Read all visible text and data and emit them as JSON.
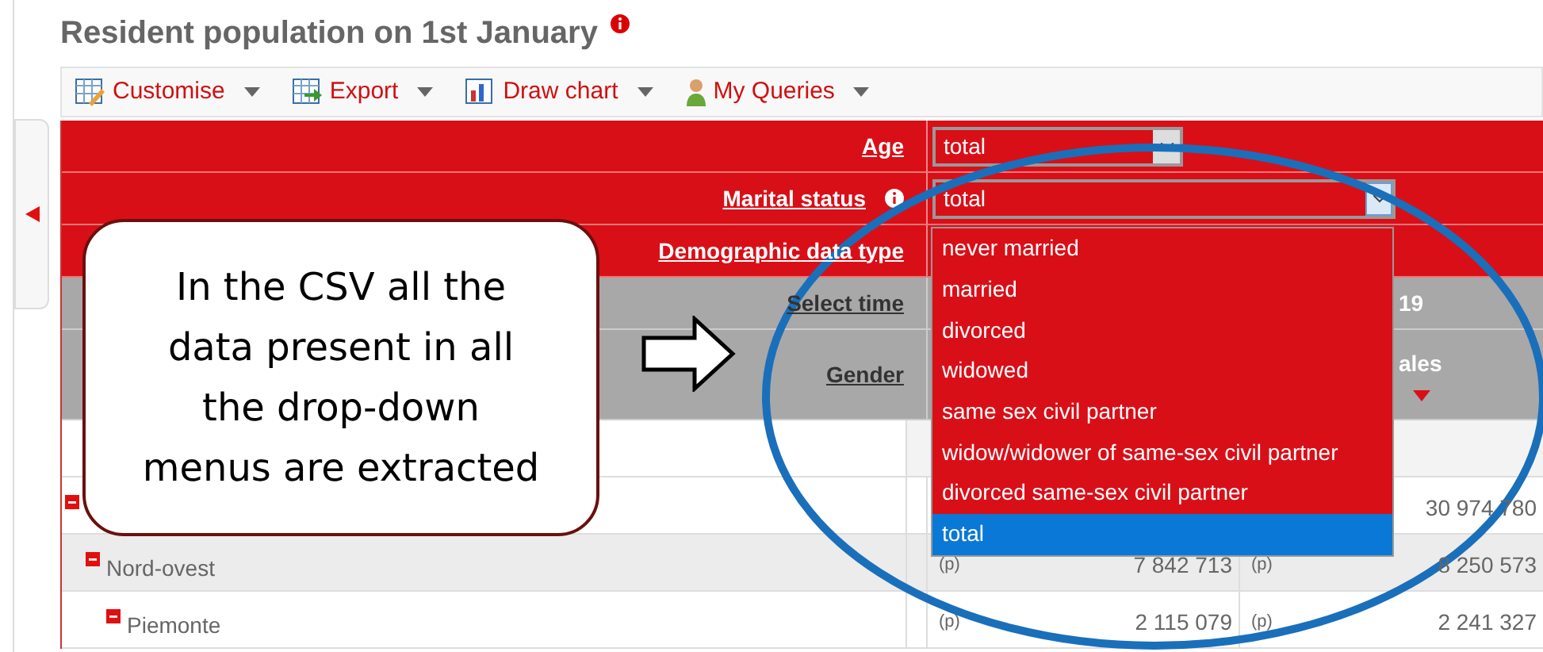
{
  "title": "Resident population on 1st January",
  "toolbar": [
    {
      "label": "Customise",
      "kind": "customise"
    },
    {
      "label": "Export",
      "kind": "export"
    },
    {
      "label": "Draw chart",
      "kind": "chart"
    },
    {
      "label": "My Queries",
      "kind": "queries"
    }
  ],
  "filters": [
    {
      "label": "Age",
      "value": "total",
      "open": false,
      "info": false
    },
    {
      "label": "Marital status",
      "value": "total",
      "open": true,
      "info": true
    },
    {
      "label": "Demographic data type",
      "info": false
    }
  ],
  "dropdown_options": [
    {
      "label": "never married",
      "selected": false
    },
    {
      "label": "married",
      "selected": false
    },
    {
      "label": "divorced",
      "selected": false
    },
    {
      "label": "widowed",
      "selected": false
    },
    {
      "label": "same sex civil partner",
      "selected": false
    },
    {
      "label": "widow/widower of same-sex civil partner",
      "selected": false
    },
    {
      "label": "divorced same-sex civil partner",
      "selected": false
    },
    {
      "label": "total",
      "selected": true
    }
  ],
  "header_rows": [
    {
      "label": "Select time",
      "column_2": "19",
      "sort": false
    },
    {
      "label": "Gender",
      "column_2": "ales",
      "sort": true
    }
  ],
  "rows": [
    {
      "expanded": true,
      "column_2": {
        "value": "30 974 780"
      },
      "children": [
        {
          "label": "Nord-ovest",
          "expanded": true,
          "column_1": {
            "flag": "(p)",
            "value": "7 842 713"
          },
          "column_2": {
            "flag": "(p)",
            "value": "8 250 573"
          },
          "children": [
            {
              "label": "Piemonte",
              "expanded": true,
              "column_1": {
                "flag": "(p)",
                "value": "2 115 079"
              },
              "column_2": {
                "flag": "(p)",
                "value": "2 241 327"
              }
            }
          ]
        }
      ]
    }
  ],
  "callout": {
    "text": "In the CSV all the\ndata present in all\nthe drop-down\nmenus are extracted"
  }
}
